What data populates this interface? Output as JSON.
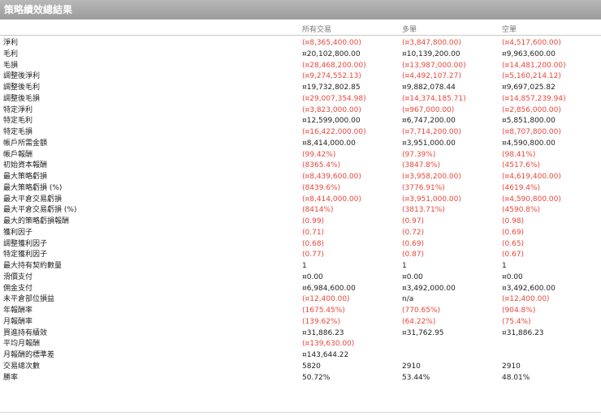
{
  "title": "策略績效總結果",
  "columns": [
    "所有交易",
    "多單",
    "空單"
  ],
  "colors": {
    "negative": "#e8473c",
    "positive": "#222222",
    "header_bg": "#a8a8a8"
  },
  "rows": [
    {
      "label": "淨利",
      "values": [
        "(¤8,365,400.00)",
        "(¤3,847,800.00)",
        "(¤4,517,600.00)"
      ],
      "neg": [
        true,
        true,
        true
      ]
    },
    {
      "label": "毛利",
      "values": [
        "¤20,102,800.00",
        "¤10,139,200.00",
        "¤9,963,600.00"
      ],
      "neg": [
        false,
        false,
        false
      ]
    },
    {
      "label": "毛損",
      "values": [
        "(¤28,468,200.00)",
        "(¤13,987,000.00)",
        "(¤14,481,200.00)"
      ],
      "neg": [
        true,
        true,
        true
      ]
    },
    {
      "label": "調整後淨利",
      "values": [
        "(¤9,274,552.13)",
        "(¤4,492,107.27)",
        "(¤5,160,214.12)"
      ],
      "neg": [
        true,
        true,
        true
      ]
    },
    {
      "label": "調整後毛利",
      "values": [
        "¤19,732,802.85",
        "¤9,882,078.44",
        "¤9,697,025.82"
      ],
      "neg": [
        false,
        false,
        false
      ]
    },
    {
      "label": "調整後毛損",
      "values": [
        "(¤29,007,354.98)",
        "(¤14,374,185.71)",
        "(¤14,857,239.94)"
      ],
      "neg": [
        true,
        true,
        true
      ]
    },
    {
      "label": "特定淨利",
      "values": [
        "(¤3,823,000.00)",
        "(¤967,000.00)",
        "(¤2,856,000.00)"
      ],
      "neg": [
        true,
        true,
        true
      ]
    },
    {
      "label": "特定毛利",
      "values": [
        "¤12,599,000.00",
        "¤6,747,200.00",
        "¤5,851,800.00"
      ],
      "neg": [
        false,
        false,
        false
      ]
    },
    {
      "label": "特定毛損",
      "values": [
        "(¤16,422,000.00)",
        "(¤7,714,200.00)",
        "(¤8,707,800.00)"
      ],
      "neg": [
        true,
        true,
        true
      ]
    },
    {
      "label": "帳戶所需金額",
      "values": [
        "¤8,414,000.00",
        "¤3,951,000.00",
        "¤4,590,800.00"
      ],
      "neg": [
        false,
        false,
        false
      ]
    },
    {
      "label": "帳戶報酬",
      "values": [
        "(99.42%)",
        "(97.39%)",
        "(98.41%)"
      ],
      "neg": [
        true,
        true,
        true
      ]
    },
    {
      "label": "初始資本報酬",
      "values": [
        "(8365.4%)",
        "(3847.8%)",
        "(4517.6%)"
      ],
      "neg": [
        true,
        true,
        true
      ]
    },
    {
      "label": "最大策略虧損",
      "values": [
        "(¤8,439,600.00)",
        "(¤3,958,200.00)",
        "(¤4,619,400.00)"
      ],
      "neg": [
        true,
        true,
        true
      ]
    },
    {
      "label": "最大策略虧損 (%)",
      "values": [
        "(8439.6%)",
        "(3776.91%)",
        "(4619.4%)"
      ],
      "neg": [
        true,
        true,
        true
      ]
    },
    {
      "label": "最大平倉交易虧損",
      "values": [
        "(¤8,414,000.00)",
        "(¤3,951,000.00)",
        "(¤4,590,800.00)"
      ],
      "neg": [
        true,
        true,
        true
      ]
    },
    {
      "label": "最大平倉交易虧損 (%)",
      "values": [
        "(8414%)",
        "(3813.71%)",
        "(4590.8%)"
      ],
      "neg": [
        true,
        true,
        true
      ]
    },
    {
      "label": "最大的策略虧損報酬",
      "values": [
        "(0.99)",
        "(0.97)",
        "(0.98)"
      ],
      "neg": [
        true,
        true,
        true
      ]
    },
    {
      "label": "獲利因子",
      "values": [
        "(0.71)",
        "(0.72)",
        "(0.69)"
      ],
      "neg": [
        true,
        true,
        true
      ]
    },
    {
      "label": "調整獲利因子",
      "values": [
        "(0.68)",
        "(0.69)",
        "(0.65)"
      ],
      "neg": [
        true,
        true,
        true
      ]
    },
    {
      "label": "特定獲利因子",
      "values": [
        "(0.77)",
        "(0.87)",
        "(0.67)"
      ],
      "neg": [
        true,
        true,
        true
      ]
    },
    {
      "label": "最大持有契約數量",
      "values": [
        "1",
        "1",
        "1"
      ],
      "neg": [
        false,
        false,
        false
      ]
    },
    {
      "label": "滑價支付",
      "values": [
        "¤0.00",
        "¤0.00",
        "¤0.00"
      ],
      "neg": [
        false,
        false,
        false
      ]
    },
    {
      "label": "佣金支付",
      "values": [
        "¤6,984,600.00",
        "¤3,492,000.00",
        "¤3,492,600.00"
      ],
      "neg": [
        false,
        false,
        false
      ]
    },
    {
      "label": "未平倉部位損益",
      "values": [
        "(¤12,400.00)",
        "n/a",
        "(¤12,400.00)"
      ],
      "neg": [
        true,
        false,
        true
      ]
    },
    {
      "label": "年報酬率",
      "values": [
        "(1675.45%)",
        "(770.65%)",
        "(904.8%)"
      ],
      "neg": [
        true,
        true,
        true
      ]
    },
    {
      "label": "月報酬率",
      "values": [
        "(139.62%)",
        "(64.22%)",
        "(75.4%)"
      ],
      "neg": [
        true,
        true,
        true
      ]
    },
    {
      "label": "買進持有績效",
      "values": [
        "¤31,886.23",
        "¤31,762.95",
        "¤31,886.23"
      ],
      "neg": [
        false,
        false,
        false
      ]
    },
    {
      "label": "平均月報酬",
      "values": [
        "(¤139,630.00)",
        "",
        ""
      ],
      "neg": [
        true,
        false,
        false
      ]
    },
    {
      "label": "月報酬的標準差",
      "values": [
        "¤143,644.22",
        "",
        ""
      ],
      "neg": [
        false,
        false,
        false
      ]
    },
    {
      "label": "交易總次數",
      "values": [
        "5820",
        "2910",
        "2910"
      ],
      "neg": [
        false,
        false,
        false
      ]
    },
    {
      "label": "勝率",
      "values": [
        "50.72%",
        "53.44%",
        "48.01%"
      ],
      "neg": [
        false,
        false,
        false
      ]
    }
  ]
}
